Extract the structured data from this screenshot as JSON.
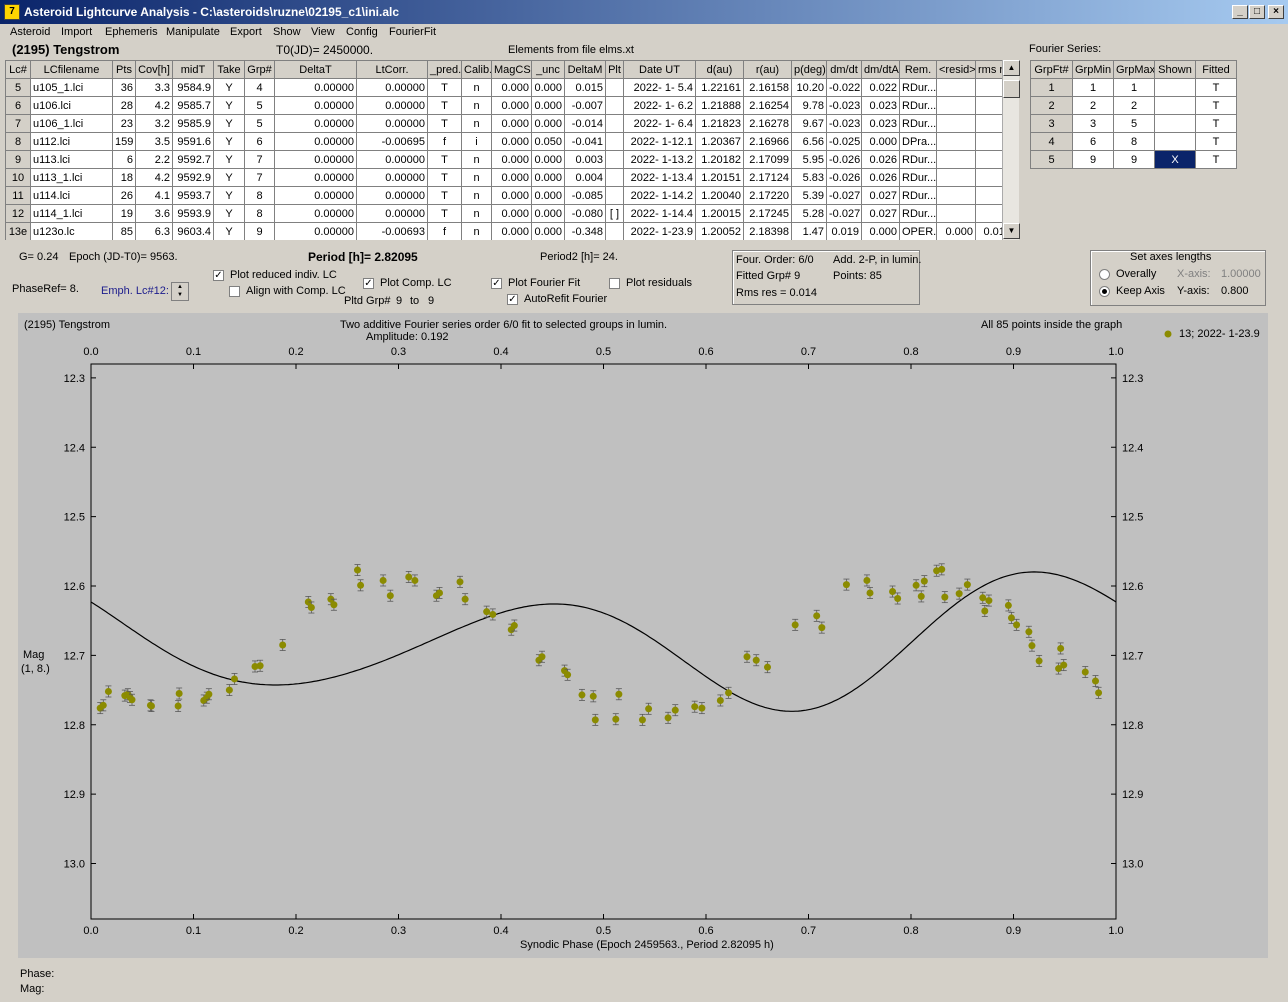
{
  "window": {
    "title": "Asteroid Lightcurve Analysis - C:\\asteroids\\ruzne\\02195_c1\\ini.alc",
    "app_icon": "7"
  },
  "menu": [
    "Asteroid",
    "Import",
    "Ephemeris",
    "Manipulate",
    "Export",
    "Show",
    "View",
    "Config",
    "FourierFit"
  ],
  "header": {
    "asteroid": "(2195) Tengstrom",
    "t0": "T0(JD)= 2450000.",
    "elements": "Elements from file elms.xt"
  },
  "lc_table": {
    "columns": [
      "Lc#",
      "LCfilename",
      "Pts",
      "Cov[h]",
      "midT",
      "Take",
      "Grp#",
      "DeltaT",
      "LtCorr.",
      "_pred.",
      "Calib.",
      "MagCS",
      "_unc",
      "DeltaM",
      "Plt",
      "Date UT",
      "d(au)",
      "r(au)",
      "p(deg)",
      "dm/dt",
      "dm/dtA",
      "Rem.",
      "<resid>",
      "rms res"
    ],
    "rows": [
      [
        "5",
        "u105_1.lci",
        "36",
        "3.3",
        "9584.9",
        "Y",
        "4",
        "0.00000",
        "0.00000",
        "T",
        "n",
        "0.000",
        "0.000",
        "0.015",
        "",
        "2022- 1- 5.4",
        "1.22161",
        "2.16158",
        "10.20",
        "-0.022",
        "0.022",
        "RDur...",
        "",
        ""
      ],
      [
        "6",
        "u106.lci",
        "28",
        "4.2",
        "9585.7",
        "Y",
        "5",
        "0.00000",
        "0.00000",
        "T",
        "n",
        "0.000",
        "0.000",
        "-0.007",
        "",
        "2022- 1- 6.2",
        "1.21888",
        "2.16254",
        "9.78",
        "-0.023",
        "0.023",
        "RDur...",
        "",
        ""
      ],
      [
        "7",
        "u106_1.lci",
        "23",
        "3.2",
        "9585.9",
        "Y",
        "5",
        "0.00000",
        "0.00000",
        "T",
        "n",
        "0.000",
        "0.000",
        "-0.014",
        "",
        "2022- 1- 6.4",
        "1.21823",
        "2.16278",
        "9.67",
        "-0.023",
        "0.023",
        "RDur...",
        "",
        ""
      ],
      [
        "8",
        "u112.lci",
        "159",
        "3.5",
        "9591.6",
        "Y",
        "6",
        "0.00000",
        "-0.00695",
        "f",
        "i",
        "0.000",
        "0.050",
        "-0.041",
        "",
        "2022- 1-12.1",
        "1.20367",
        "2.16966",
        "6.56",
        "-0.025",
        "0.000",
        "DPra...",
        "",
        ""
      ],
      [
        "9",
        "u113.lci",
        "6",
        "2.2",
        "9592.7",
        "Y",
        "7",
        "0.00000",
        "0.00000",
        "T",
        "n",
        "0.000",
        "0.000",
        "0.003",
        "",
        "2022- 1-13.2",
        "1.20182",
        "2.17099",
        "5.95",
        "-0.026",
        "0.026",
        "RDur...",
        "",
        ""
      ],
      [
        "10",
        "u113_1.lci",
        "18",
        "4.2",
        "9592.9",
        "Y",
        "7",
        "0.00000",
        "0.00000",
        "T",
        "n",
        "0.000",
        "0.000",
        "0.004",
        "",
        "2022- 1-13.4",
        "1.20151",
        "2.17124",
        "5.83",
        "-0.026",
        "0.026",
        "RDur...",
        "",
        ""
      ],
      [
        "11",
        "u114.lci",
        "26",
        "4.1",
        "9593.7",
        "Y",
        "8",
        "0.00000",
        "0.00000",
        "T",
        "n",
        "0.000",
        "0.000",
        "-0.085",
        "",
        "2022- 1-14.2",
        "1.20040",
        "2.17220",
        "5.39",
        "-0.027",
        "0.027",
        "RDur...",
        "",
        ""
      ],
      [
        "12",
        "u114_1.lci",
        "19",
        "3.6",
        "9593.9",
        "Y",
        "8",
        "0.00000",
        "0.00000",
        "T",
        "n",
        "0.000",
        "0.000",
        "-0.080",
        "[ ]",
        "2022- 1-14.4",
        "1.20015",
        "2.17245",
        "5.28",
        "-0.027",
        "0.027",
        "RDur...",
        "",
        ""
      ],
      [
        "13e",
        "u123o.lc",
        "85",
        "6.3",
        "9603.4",
        "Y",
        "9",
        "0.00000",
        "-0.00693",
        "f",
        "n",
        "0.000",
        "0.000",
        "-0.348",
        "",
        "2022- 1-23.9",
        "1.20052",
        "2.18398",
        "1.47",
        "0.019",
        "0.000",
        "OPER...",
        "0.000",
        "0.012"
      ]
    ]
  },
  "fourier_series": {
    "title": "Fourier Series:",
    "columns": [
      "GrpFt#",
      "GrpMin",
      "GrpMax",
      "Shown",
      "Fitted"
    ],
    "rows": [
      [
        "1",
        "1",
        "1",
        "",
        "T"
      ],
      [
        "2",
        "2",
        "2",
        "",
        "T"
      ],
      [
        "3",
        "3",
        "5",
        "",
        "T"
      ],
      [
        "4",
        "6",
        "8",
        "",
        "T"
      ],
      [
        "5",
        "9",
        "9",
        "X",
        "T"
      ]
    ]
  },
  "controls": {
    "g": "G= 0.24",
    "epoch": "Epoch (JD-T0)= 9563.",
    "period": "Period [h]= 2.82095",
    "period2": "Period2 [h]= 24.",
    "phaseref": "PhaseRef= 8.",
    "emph": "Emph. Lc#12:",
    "plot_reduced": "Plot reduced indiv. LC",
    "align_comp": "Align with Comp. LC",
    "plot_comp": "Plot Comp. LC",
    "pltd_grp": "Pltd Grp#",
    "grp_from": "9",
    "to_label": "to",
    "grp_to": "9",
    "plot_fourier": "Plot Fourier Fit",
    "plot_residuals": "Plot residuals",
    "autorefit": "AutoRefit Fourier",
    "four_order": "Four. Order:  6/0",
    "add_2p": "Add. 2-P, in lumin.",
    "fitted_grp": "Fitted Grp# 9",
    "points": "Points: 85",
    "rms": "Rms res     = 0.014",
    "axes_title": "Set axes lengths",
    "overally": "Overally",
    "keep_axis": "Keep Axis",
    "x_axis_label": "X-axis:",
    "x_axis_val": "1.00000",
    "y_axis_label": "Y-axis:",
    "y_axis_val": "0.800"
  },
  "footer": {
    "phase": "Phase:",
    "mag": "Mag:"
  },
  "colors": {
    "points": "#8b8b00",
    "plot_bg": "#c0c0c0",
    "selection": "#0a246a"
  },
  "chart_data": {
    "type": "scatter",
    "title": "Two additive Fourier series order 6/0 fit to selected groups in lumin.",
    "subtitle": "Amplitude: 0.192",
    "corner_left": "(2195) Tengstrom",
    "corner_right": "All 85 points inside the graph",
    "legend": "13; 2022- 1-23.9",
    "xlabel": "Synodic Phase (Epoch 2459563., Period 2.82095 h)",
    "ylabel": "Mag",
    "ylabel2": "(1, 8.)",
    "xlim": [
      0,
      1
    ],
    "ylim": [
      13.08,
      12.28
    ],
    "xticks": [
      "0.0",
      "0.1",
      "0.2",
      "0.3",
      "0.4",
      "0.5",
      "0.6",
      "0.7",
      "0.8",
      "0.9",
      "1.0"
    ],
    "yticks": [
      "12.3",
      "12.4",
      "12.5",
      "12.6",
      "12.7",
      "12.8",
      "12.9",
      "13.0"
    ],
    "error": 0.008,
    "points": [
      [
        0.009,
        12.776
      ],
      [
        0.012,
        12.772
      ],
      [
        0.017,
        12.752
      ],
      [
        0.033,
        12.758
      ],
      [
        0.036,
        12.756
      ],
      [
        0.038,
        12.76
      ],
      [
        0.04,
        12.764
      ],
      [
        0.058,
        12.772
      ],
      [
        0.059,
        12.773
      ],
      [
        0.085,
        12.773
      ],
      [
        0.086,
        12.755
      ],
      [
        0.11,
        12.765
      ],
      [
        0.113,
        12.761
      ],
      [
        0.115,
        12.756
      ],
      [
        0.135,
        12.75
      ],
      [
        0.14,
        12.734
      ],
      [
        0.16,
        12.716
      ],
      [
        0.165,
        12.715
      ],
      [
        0.187,
        12.685
      ],
      [
        0.212,
        12.623
      ],
      [
        0.215,
        12.631
      ],
      [
        0.234,
        12.619
      ],
      [
        0.237,
        12.627
      ],
      [
        0.26,
        12.577
      ],
      [
        0.263,
        12.599
      ],
      [
        0.285,
        12.592
      ],
      [
        0.292,
        12.614
      ],
      [
        0.31,
        12.587
      ],
      [
        0.316,
        12.592
      ],
      [
        0.337,
        12.614
      ],
      [
        0.34,
        12.61
      ],
      [
        0.36,
        12.594
      ],
      [
        0.365,
        12.619
      ],
      [
        0.386,
        12.637
      ],
      [
        0.392,
        12.641
      ],
      [
        0.41,
        12.663
      ],
      [
        0.413,
        12.657
      ],
      [
        0.437,
        12.707
      ],
      [
        0.44,
        12.702
      ],
      [
        0.462,
        12.722
      ],
      [
        0.465,
        12.728
      ],
      [
        0.479,
        12.757
      ],
      [
        0.49,
        12.759
      ],
      [
        0.492,
        12.793
      ],
      [
        0.512,
        12.792
      ],
      [
        0.515,
        12.756
      ],
      [
        0.538,
        12.793
      ],
      [
        0.544,
        12.777
      ],
      [
        0.563,
        12.79
      ],
      [
        0.57,
        12.779
      ],
      [
        0.589,
        12.774
      ],
      [
        0.596,
        12.776
      ],
      [
        0.614,
        12.765
      ],
      [
        0.622,
        12.754
      ],
      [
        0.64,
        12.702
      ],
      [
        0.649,
        12.707
      ],
      [
        0.66,
        12.717
      ],
      [
        0.687,
        12.656
      ],
      [
        0.708,
        12.643
      ],
      [
        0.713,
        12.66
      ],
      [
        0.737,
        12.598
      ],
      [
        0.757,
        12.592
      ],
      [
        0.76,
        12.61
      ],
      [
        0.782,
        12.608
      ],
      [
        0.787,
        12.618
      ],
      [
        0.805,
        12.599
      ],
      [
        0.81,
        12.615
      ],
      [
        0.813,
        12.593
      ],
      [
        0.825,
        12.578
      ],
      [
        0.83,
        12.576
      ],
      [
        0.833,
        12.616
      ],
      [
        0.847,
        12.611
      ],
      [
        0.855,
        12.598
      ],
      [
        0.87,
        12.617
      ],
      [
        0.872,
        12.636
      ],
      [
        0.876,
        12.621
      ],
      [
        0.895,
        12.628
      ],
      [
        0.898,
        12.646
      ],
      [
        0.903,
        12.656
      ],
      [
        0.915,
        12.666
      ],
      [
        0.918,
        12.686
      ],
      [
        0.925,
        12.708
      ],
      [
        0.944,
        12.719
      ],
      [
        0.946,
        12.69
      ],
      [
        0.949,
        12.714
      ],
      [
        0.97,
        12.724
      ],
      [
        0.98,
        12.737
      ],
      [
        0.983,
        12.754
      ]
    ],
    "fourier": {
      "mean": 12.683,
      "a1": -0.018,
      "b1": 0.001,
      "a2": -0.052,
      "b2": 0.059,
      "a3": 0.01,
      "b3": 0.01
    }
  }
}
